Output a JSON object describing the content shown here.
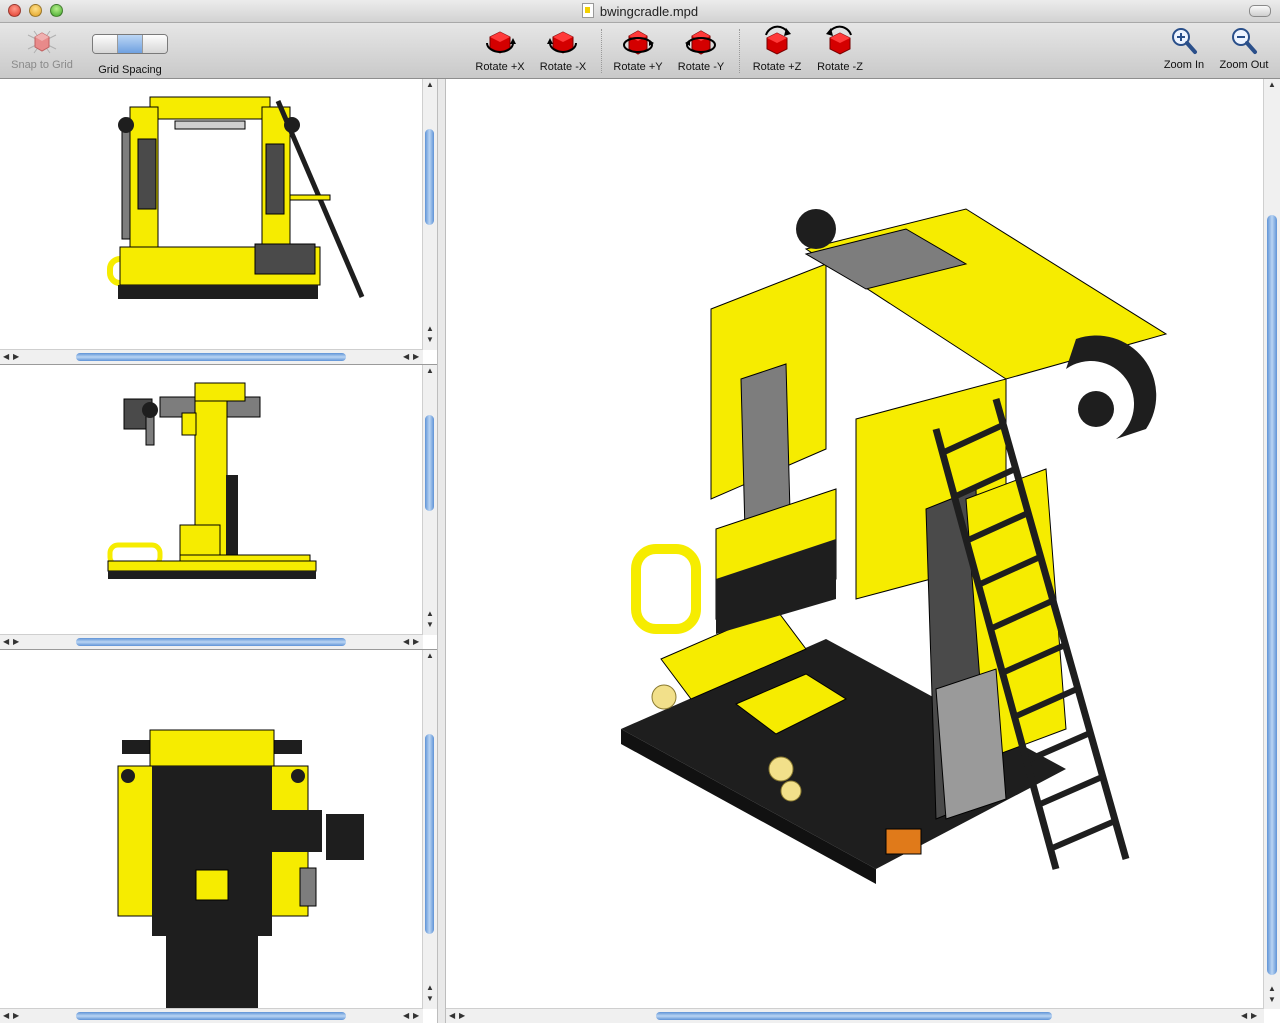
{
  "window": {
    "title": "bwingcradle.mpd"
  },
  "toolbar": {
    "snap_label": "Snap to Grid",
    "grid_label": "Grid Spacing",
    "rotate_px": "Rotate +X",
    "rotate_mx": "Rotate -X",
    "rotate_py": "Rotate +Y",
    "rotate_my": "Rotate -Y",
    "rotate_pz": "Rotate +Z",
    "rotate_mz": "Rotate -Z",
    "zoom_in": "Zoom In",
    "zoom_out": "Zoom Out"
  },
  "colors": {
    "brick_yellow": "#f6ec00",
    "brick_black": "#1e1e1e",
    "brick_gray": "#7d7d7d",
    "brick_dark_gray": "#4a4a4a",
    "scroll_thumb": "#6f9fe0",
    "rotate_icon": "#d40000"
  },
  "icons": {
    "snap": "snap-grid-brick-icon",
    "rotate": "rotate-brick-icon",
    "zoom_in": "magnifier-plus-icon",
    "zoom_out": "magnifier-minus-icon"
  }
}
